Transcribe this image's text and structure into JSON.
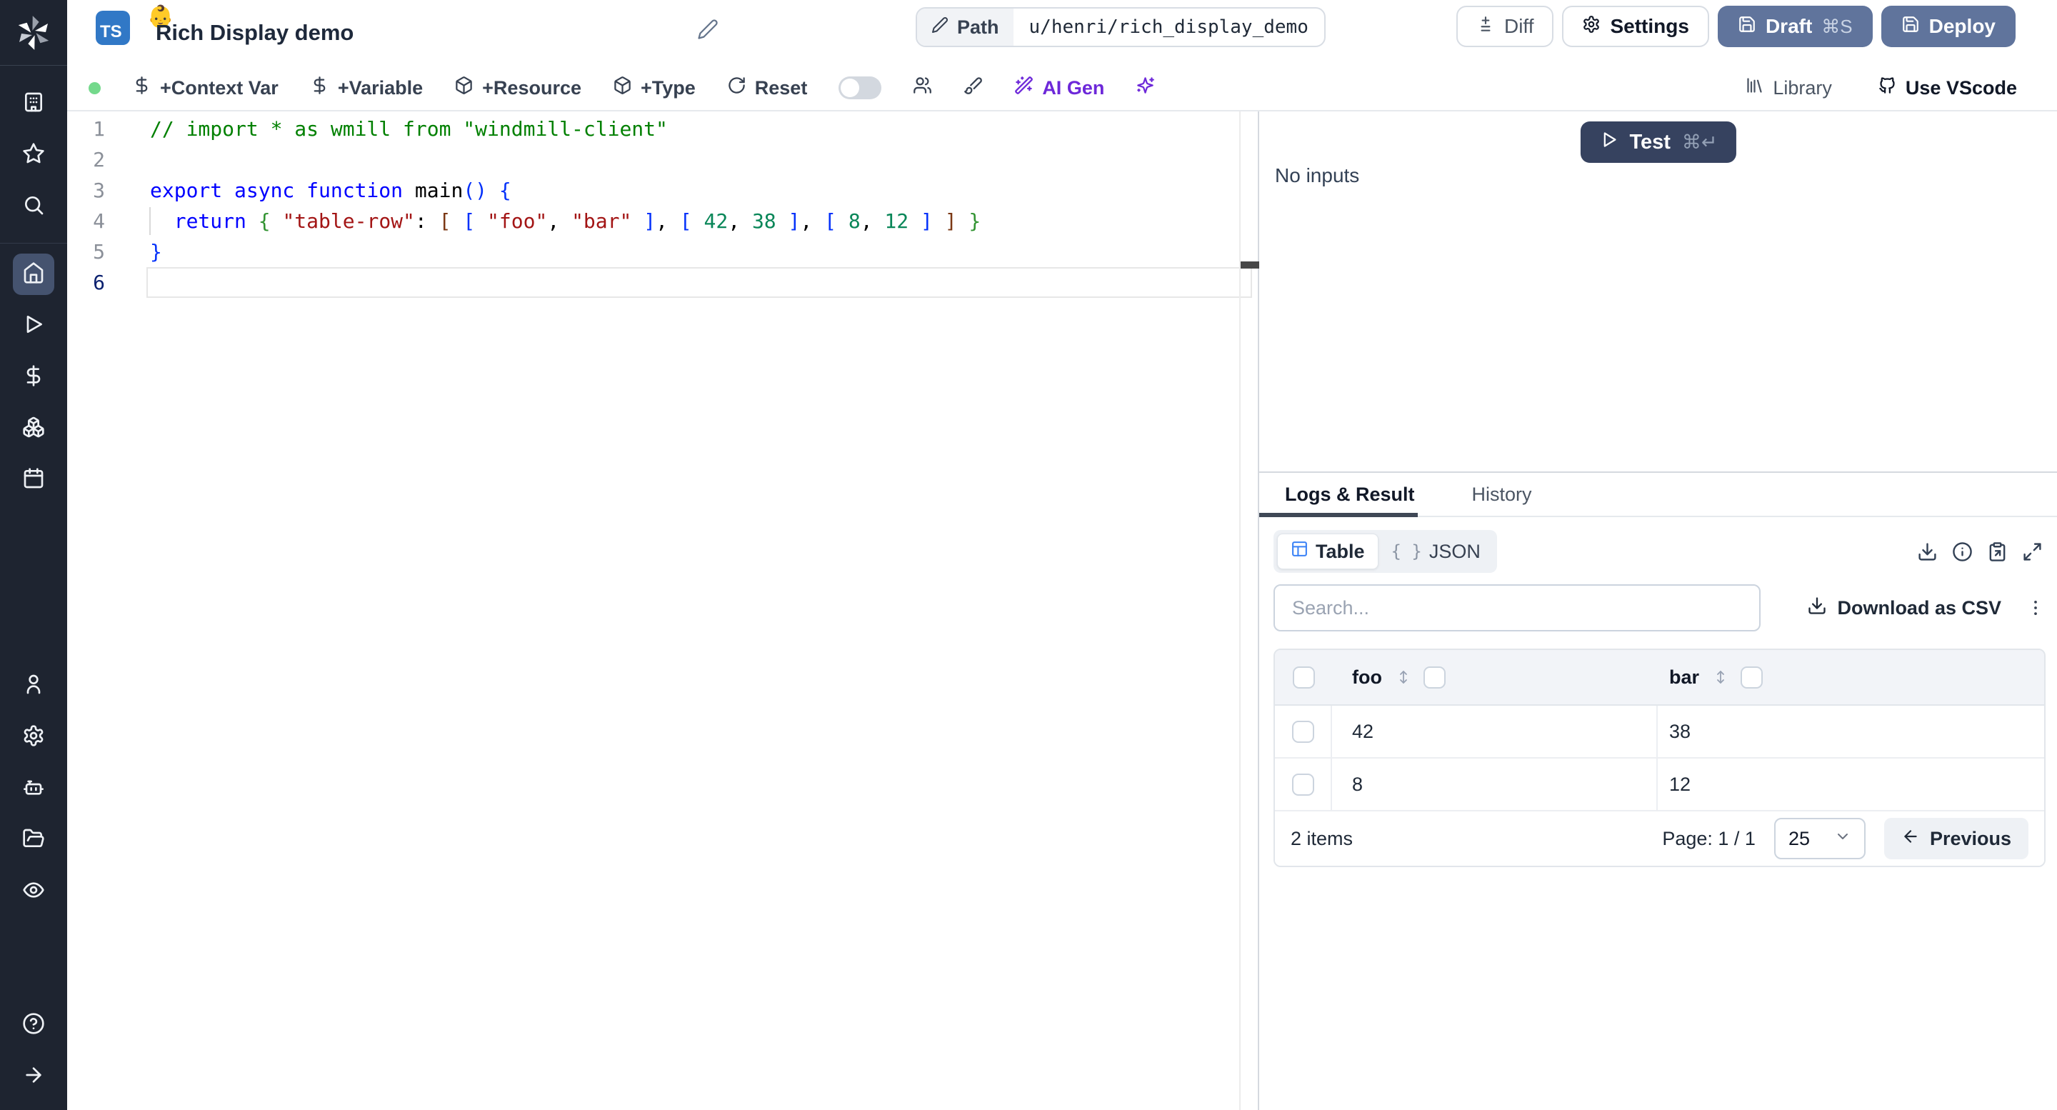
{
  "header": {
    "language_badge": "TS",
    "badge_emoji": "👶",
    "title": "Rich Display demo",
    "path_label": "Path",
    "path_value": "u/henri/rich_display_demo",
    "diff": "Diff",
    "settings": "Settings",
    "draft": "Draft",
    "draft_shortcut": "⌘S",
    "deploy": "Deploy"
  },
  "toolbar": {
    "context_var": "+Context Var",
    "variable": "+Variable",
    "resource": "+Resource",
    "type": "+Type",
    "reset": "Reset",
    "ai_gen": "AI Gen",
    "library": "Library",
    "use_vscode": "Use VScode"
  },
  "sidebar": {
    "icons": [
      "windmill-logo",
      "building",
      "star",
      "search",
      "home",
      "play",
      "dollar",
      "boxes",
      "calendar",
      "user",
      "gear",
      "robot",
      "folder-open",
      "eye",
      "help",
      "arrow-right"
    ],
    "active": "home"
  },
  "editor": {
    "active_line": 6,
    "lines": [
      {
        "n": 1,
        "segs": [
          {
            "c": "cm",
            "t": "// import * as wmill from \"windmill-client\""
          }
        ]
      },
      {
        "n": 2,
        "segs": []
      },
      {
        "n": 3,
        "segs": [
          {
            "c": "kw",
            "t": "export async function"
          },
          {
            "c": "pl",
            "t": " main"
          },
          {
            "c": "b1",
            "t": "()"
          },
          {
            "c": "pl",
            "t": " "
          },
          {
            "c": "b1",
            "t": "{"
          }
        ]
      },
      {
        "n": 4,
        "guide": true,
        "segs": [
          {
            "c": "pl",
            "t": "  "
          },
          {
            "c": "kw",
            "t": "return"
          },
          {
            "c": "pl",
            "t": " "
          },
          {
            "c": "b2",
            "t": "{"
          },
          {
            "c": "pl",
            "t": " "
          },
          {
            "c": "str",
            "t": "\"table-row\""
          },
          {
            "c": "pl",
            "t": ": "
          },
          {
            "c": "b3",
            "t": "["
          },
          {
            "c": "pl",
            "t": " "
          },
          {
            "c": "b1",
            "t": "["
          },
          {
            "c": "pl",
            "t": " "
          },
          {
            "c": "str",
            "t": "\"foo\""
          },
          {
            "c": "pl",
            "t": ", "
          },
          {
            "c": "str",
            "t": "\"bar\""
          },
          {
            "c": "pl",
            "t": " "
          },
          {
            "c": "b1",
            "t": "]"
          },
          {
            "c": "pl",
            "t": ", "
          },
          {
            "c": "b1",
            "t": "["
          },
          {
            "c": "pl",
            "t": " "
          },
          {
            "c": "num",
            "t": "42"
          },
          {
            "c": "pl",
            "t": ", "
          },
          {
            "c": "num",
            "t": "38"
          },
          {
            "c": "pl",
            "t": " "
          },
          {
            "c": "b1",
            "t": "]"
          },
          {
            "c": "pl",
            "t": ", "
          },
          {
            "c": "b1",
            "t": "["
          },
          {
            "c": "pl",
            "t": " "
          },
          {
            "c": "num",
            "t": "8"
          },
          {
            "c": "pl",
            "t": ", "
          },
          {
            "c": "num",
            "t": "12"
          },
          {
            "c": "pl",
            "t": " "
          },
          {
            "c": "b1",
            "t": "]"
          },
          {
            "c": "pl",
            "t": " "
          },
          {
            "c": "b3",
            "t": "]"
          },
          {
            "c": "pl",
            "t": " "
          },
          {
            "c": "b2",
            "t": "}"
          }
        ]
      },
      {
        "n": 5,
        "segs": [
          {
            "c": "b1",
            "t": "}"
          }
        ]
      },
      {
        "n": 6,
        "segs": []
      }
    ]
  },
  "run_panel": {
    "test": "Test",
    "test_shortcut": "⌘↵",
    "no_inputs": "No inputs",
    "tabs": [
      {
        "label": "Logs & Result",
        "active": true
      },
      {
        "label": "History",
        "active": false
      }
    ],
    "view_modes": [
      {
        "label": "Table",
        "active": true
      },
      {
        "label": "JSON",
        "active": false
      }
    ],
    "search_placeholder": "Search...",
    "download_csv": "Download as CSV",
    "table": {
      "columns": [
        "foo",
        "bar"
      ],
      "rows": [
        [
          "42",
          "38"
        ],
        [
          "8",
          "12"
        ]
      ]
    },
    "footer": {
      "count": "2 items",
      "page": "Page: 1 / 1",
      "page_size": "25",
      "previous": "Previous"
    }
  },
  "colors": {
    "sidebar_bg": "#1e2430",
    "sidebar_active": "#45536f",
    "primary_button": "#60749c",
    "test_button": "#36425f",
    "accent_purple": "#6d28d9",
    "status_green": "#74d98c",
    "ts_badge_blue": "#3178c6",
    "table_icon_blue": "#3b82f6",
    "code_comment": "#008000",
    "code_keyword": "#0000ff",
    "code_string": "#a31515",
    "code_number": "#098658"
  }
}
